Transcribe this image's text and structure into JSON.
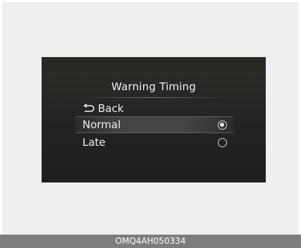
{
  "menu": {
    "title": "Warning Timing",
    "back_label": "Back",
    "options": [
      {
        "label": "Normal",
        "selected": true
      },
      {
        "label": "Late",
        "selected": false
      }
    ]
  },
  "caption": "OMQ4AH050334",
  "icons": {
    "back": "back-arrow-icon",
    "radio_selected": "radio-selected-icon",
    "radio_unselected": "radio-unselected-icon"
  },
  "colors": {
    "screen_background": "#242321",
    "text": "#f0f0f0",
    "caption_bar": "#7d7d7d"
  }
}
